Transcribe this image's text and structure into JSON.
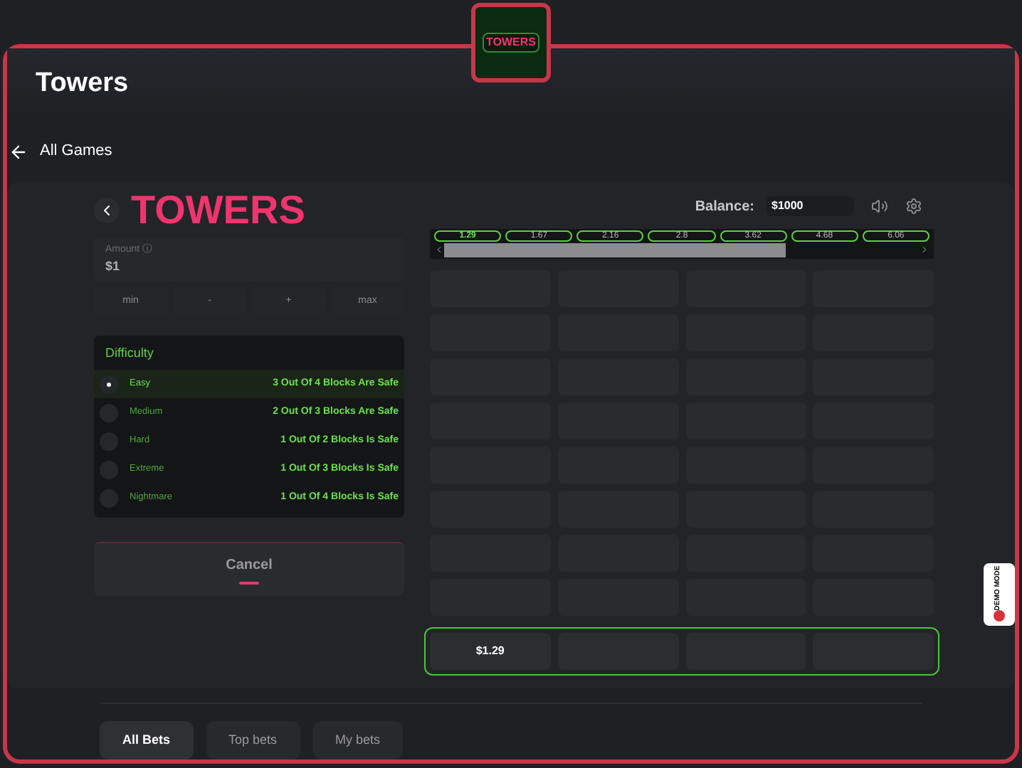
{
  "header": {
    "title": "Towers",
    "thumbnail_label": "TOWERS"
  },
  "back_link": "All Games",
  "game": {
    "logo": "TOWERS",
    "amount": {
      "label": "Amount ⓘ",
      "value": "$1"
    },
    "amount_buttons": [
      "min",
      "-",
      "+",
      "max"
    ],
    "difficulty": {
      "title": "Difficulty",
      "options": [
        {
          "name": "Easy",
          "description": "3 Out Of 4 Blocks Are Safe",
          "selected": true
        },
        {
          "name": "Medium",
          "description": "2 Out Of 3 Blocks Are Safe",
          "selected": false
        },
        {
          "name": "Hard",
          "description": "1 Out Of 2 Blocks Is Safe",
          "selected": false
        },
        {
          "name": "Extreme",
          "description": "1 Out Of 3 Blocks Is Safe",
          "selected": false
        },
        {
          "name": "Nightmare",
          "description": "1 Out Of 4 Blocks Is Safe",
          "selected": false
        }
      ]
    },
    "cancel_button": "Cancel",
    "balance": {
      "label": "Balance:",
      "value": "$1000"
    },
    "multipliers": [
      {
        "value": "1.29",
        "selected": true
      },
      {
        "value": "1.67",
        "selected": false
      },
      {
        "value": "2.16",
        "selected": false
      },
      {
        "value": "2.8",
        "selected": false
      },
      {
        "value": "3.62",
        "selected": false
      },
      {
        "value": "4.68",
        "selected": false
      },
      {
        "value": "6.06",
        "selected": false
      }
    ],
    "tower_rows": [
      {
        "active": false
      },
      {
        "active": false
      },
      {
        "active": false
      },
      {
        "active": false
      },
      {
        "active": false
      },
      {
        "active": false
      },
      {
        "active": false
      },
      {
        "active": false
      },
      {
        "active": true,
        "payout": "$1.29"
      }
    ]
  },
  "bet_tabs": [
    {
      "label": "All Bets",
      "selected": true
    },
    {
      "label": "Top bets",
      "selected": false
    },
    {
      "label": "My bets",
      "selected": false
    }
  ],
  "demo_badge": "DEMO MODE"
}
